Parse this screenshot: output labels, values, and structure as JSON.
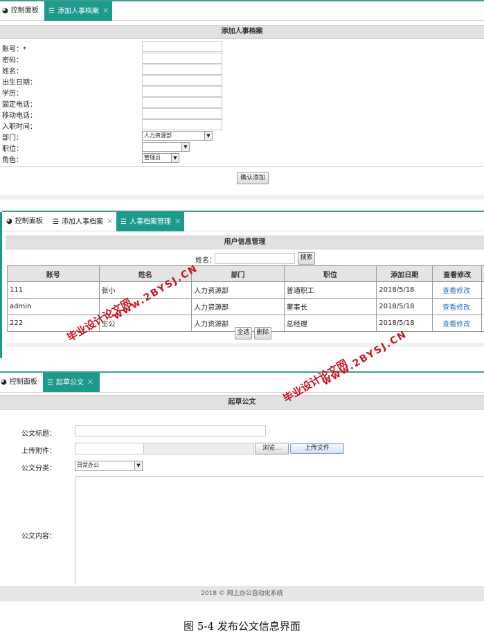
{
  "panel1": {
    "tabs": [
      "控制面板",
      "添加人事档案"
    ],
    "header": "添加人事档案",
    "fields": {
      "account": "账号：*",
      "password": "密码：",
      "name": "姓名：",
      "birth": "出生日期：",
      "education": "学历：",
      "phone": "固定电话：",
      "mobile": "移动电话：",
      "hire": "入职时间：",
      "dept": "部门：",
      "position": "职位：",
      "role": "角色："
    },
    "dept_value": "人力资源部",
    "position_value": "",
    "role_value": "管理员",
    "confirm_button": "确认添加"
  },
  "panel2": {
    "tabs": [
      "控制面板",
      "添加人事档案",
      "人事档案管理"
    ],
    "header": "用户信息管理",
    "search_label": "姓名：",
    "search_value": "",
    "search_button": "搜索",
    "columns": [
      "账号",
      "姓名",
      "部门",
      "职位",
      "添加日期",
      "查看修改"
    ],
    "rows": [
      [
        "111",
        "张小",
        "人力资源部",
        "普通职工",
        "2018/5/18",
        "查看修改"
      ],
      [
        "admin",
        "",
        "人力资源部",
        "董事长",
        "2018/5/18",
        "查看修改"
      ],
      [
        "222",
        "王公",
        "人力资源部",
        "总经理",
        "2018/5/18",
        "查看修改"
      ]
    ],
    "select_all_button": "全选",
    "delete_button": "删除"
  },
  "panel3": {
    "tabs": [
      "控制面板",
      "起草公文"
    ],
    "header": "起草公文",
    "title_label": "公文标题：",
    "title_value": "",
    "attach_label": "上传附件：",
    "browse_button": "浏览...",
    "upload_button": "上传文件",
    "category_label": "公文分类：",
    "category_value": "日常办公",
    "content_label": "公文内容：",
    "content_value": "",
    "footer": "2018 © 网上办公自动化系统"
  },
  "watermarks": [
    "毕业设计论文网",
    "www.2BYSJ.CN"
  ],
  "caption": "图 5-4 发布公文信息界面",
  "colors": {
    "accent": "#1c9a8c",
    "watermark": "#c8141f",
    "link": "#2a6fc4"
  }
}
